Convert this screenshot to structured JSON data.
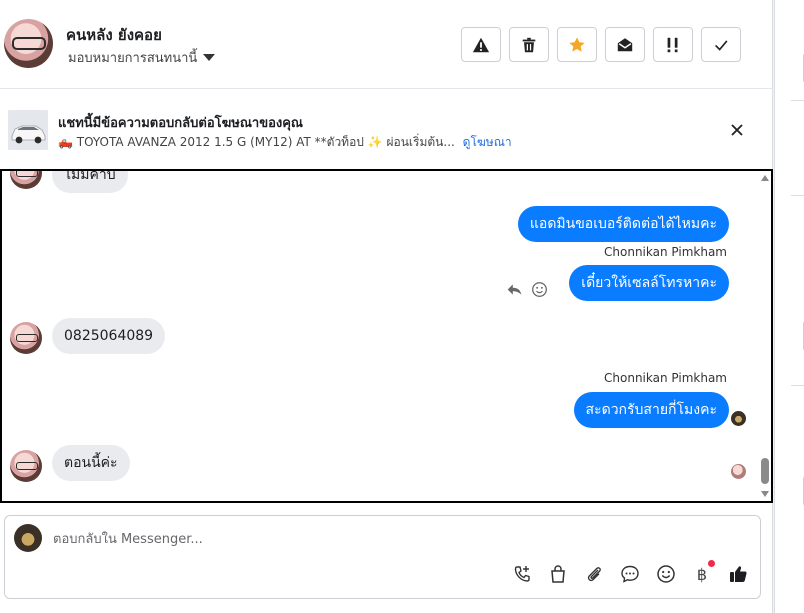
{
  "header": {
    "contact_name": "คนหลัง ยังคอย",
    "assign_label": "มอบหมายการสนทนานี้",
    "actions": [
      {
        "name": "spam-button",
        "icon": "warning-icon"
      },
      {
        "name": "delete-button",
        "icon": "trash-icon"
      },
      {
        "name": "star-button",
        "icon": "star-icon"
      },
      {
        "name": "mark-unread-button",
        "icon": "envelope-open-icon"
      },
      {
        "name": "priority-button",
        "icon": "exclamation-icon"
      },
      {
        "name": "done-button",
        "icon": "check-icon"
      }
    ],
    "star_color": "#f5a623"
  },
  "ad": {
    "title": "แชทนี้มีข้อความตอบกลับต่อโฆษณาของคุณ",
    "description": "🛻 TOYOTA AVANZA 2012 1.5 G (MY12) AT **ตัวท็อป ✨ ผ่อนเริ่มต้น...",
    "link_label": "ดูโฆษณา"
  },
  "messages": {
    "partial_top": "ไม่มีค่าบ",
    "out_1": "แอดมินขอเบอร์ติดต่อได้ไหมคะ",
    "sender_1": "Chonnikan Pimkham",
    "out_2": "เดี๋ยวให้เซลล์โทรหาคะ",
    "in_1": "0825064089",
    "sender_2": "Chonnikan Pimkham",
    "out_3": "สะดวกรับสายกี่โมงคะ",
    "in_2": "ตอนนี้ค่ะ"
  },
  "composer": {
    "placeholder": "ตอบกลับใน Messenger...",
    "tools": [
      "call-icon",
      "shopping-bag-icon",
      "paperclip-icon",
      "chat-icon",
      "emoji-icon",
      "baht-icon",
      "thumbs-up-icon"
    ],
    "baht_symbol": "฿"
  },
  "colors": {
    "outgoing_bubble": "#0a7cff",
    "incoming_bubble": "#e9ebee",
    "link": "#216fdb"
  }
}
